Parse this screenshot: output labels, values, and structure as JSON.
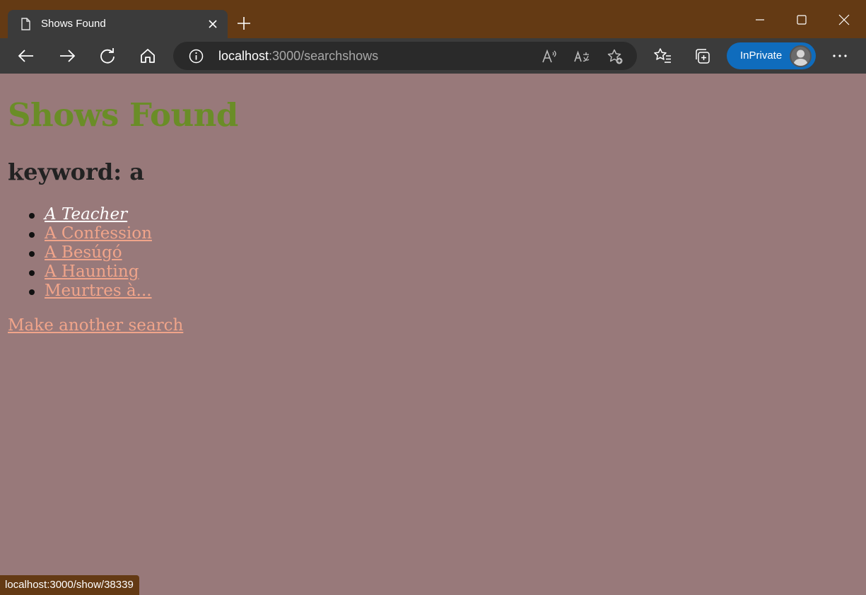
{
  "browser": {
    "tab": {
      "title": "Shows Found",
      "favicon": "page-icon"
    },
    "address": {
      "host": "localhost",
      "rest": ":3000/searchshows"
    },
    "inprivate_label": "InPrivate",
    "status_url": "localhost:3000/show/38339",
    "colors": {
      "frame": "#643a14",
      "toolbar": "#3b3b3b",
      "inprivate": "#0f6cbd"
    }
  },
  "page": {
    "title": "Shows Found",
    "keyword_label": "keyword:",
    "keyword_value": "a",
    "results": [
      {
        "label": "A Teacher",
        "state": "hovered"
      },
      {
        "label": "A Confession"
      },
      {
        "label": "A Besúgó"
      },
      {
        "label": "A Haunting"
      },
      {
        "label": "Meurtres à..."
      }
    ],
    "another_search": "Make another search",
    "colors": {
      "background": "#98797a",
      "title": "#6a8d27",
      "link": "#f0a48a"
    }
  }
}
